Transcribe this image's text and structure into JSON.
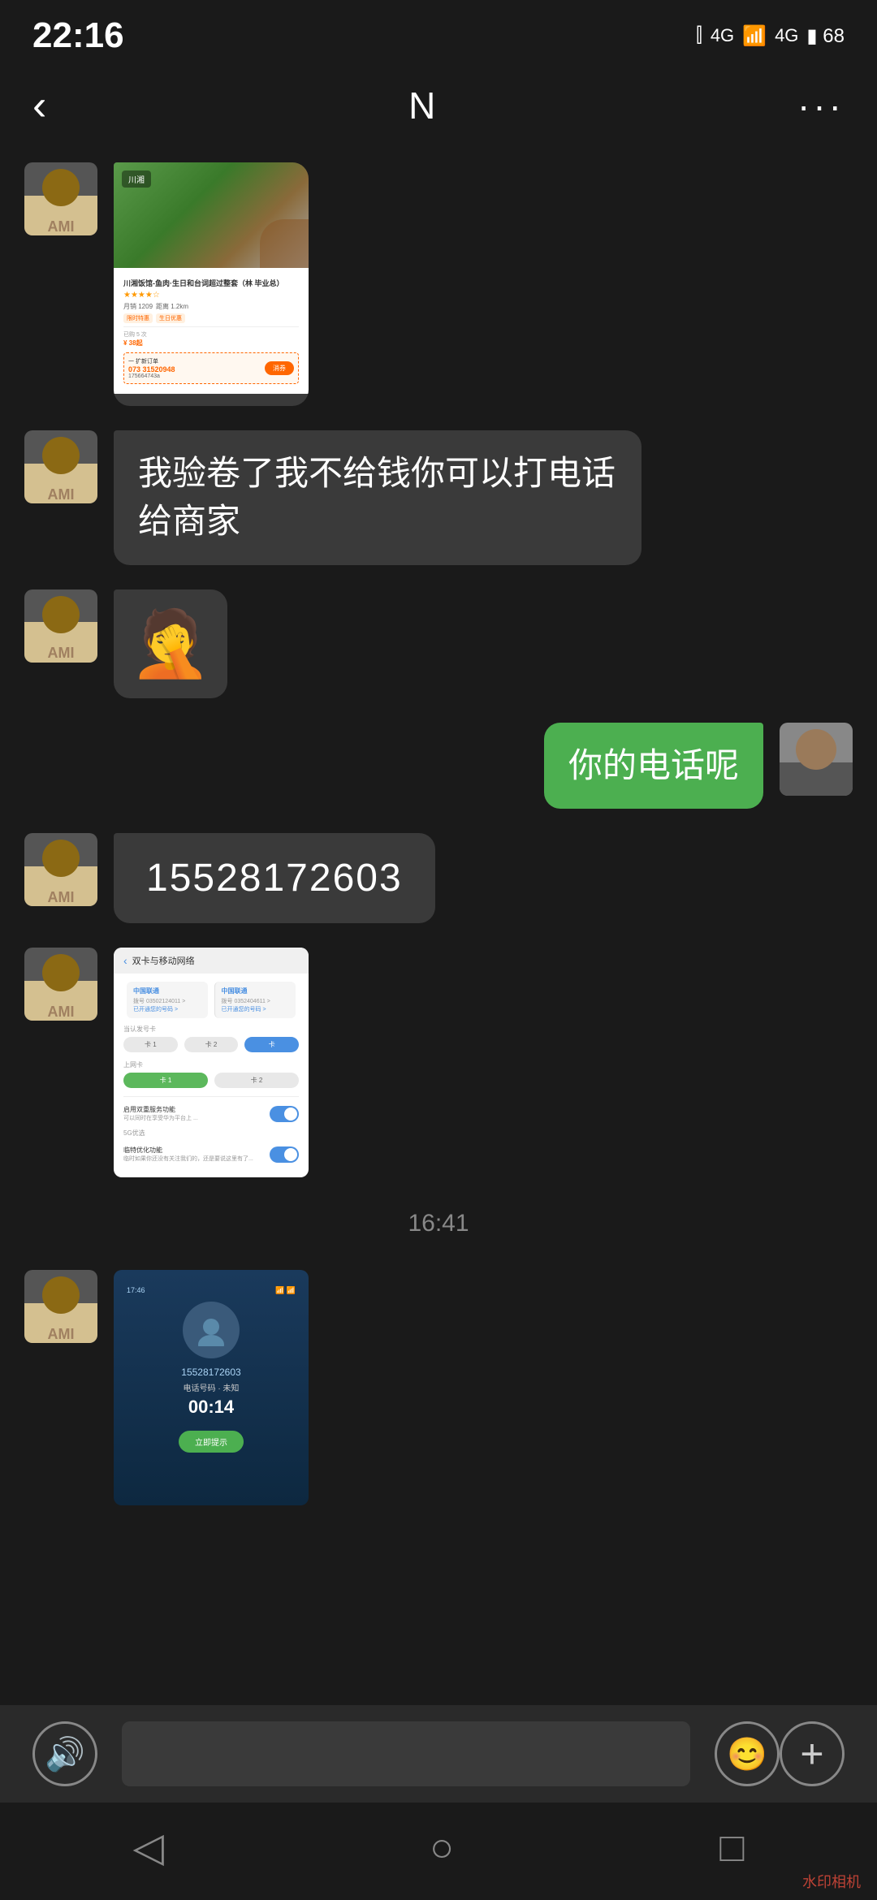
{
  "status_bar": {
    "time": "22:16",
    "icons": [
      "📶",
      "4G",
      "📶",
      "4G",
      "🔋68"
    ]
  },
  "header": {
    "back_label": "‹",
    "title": "N",
    "more_label": "···"
  },
  "messages": [
    {
      "id": "msg1",
      "type": "left_image",
      "avatar": "ahi"
    },
    {
      "id": "msg2",
      "type": "left_text",
      "avatar": "ahi",
      "text": "我验卷了我不给钱你可以打电话给商家"
    },
    {
      "id": "msg3",
      "type": "left_emoji",
      "avatar": "ahi",
      "emoji": "🤦"
    },
    {
      "id": "msg4",
      "type": "right_text",
      "text": "你的电话呢"
    },
    {
      "id": "msg5",
      "type": "left_phone",
      "avatar": "ahi",
      "phone": "15528172603"
    },
    {
      "id": "msg6",
      "type": "left_screenshot",
      "avatar": "ahi"
    },
    {
      "id": "timestamp",
      "type": "timestamp",
      "text": "16:41"
    },
    {
      "id": "msg7",
      "type": "left_call",
      "avatar": "ahi"
    }
  ],
  "bottom_bar": {
    "voice_icon": "🔊",
    "emoji_icon": "😊",
    "plus_icon": "+"
  },
  "nav_bar": {
    "back_icon": "◁",
    "home_icon": "○",
    "recent_icon": "□",
    "watermark": "水印相机"
  },
  "sim_screen": {
    "title": "双卡与移动网络",
    "card1_name": "中国联通",
    "card2_name": "中国联通",
    "default_call": "当认发号卡",
    "sim_card": "上网卡"
  },
  "call_screen": {
    "number": "15528172603",
    "sub": "电话号码 · 未知",
    "duration": "00:14",
    "button": "立即提示"
  }
}
